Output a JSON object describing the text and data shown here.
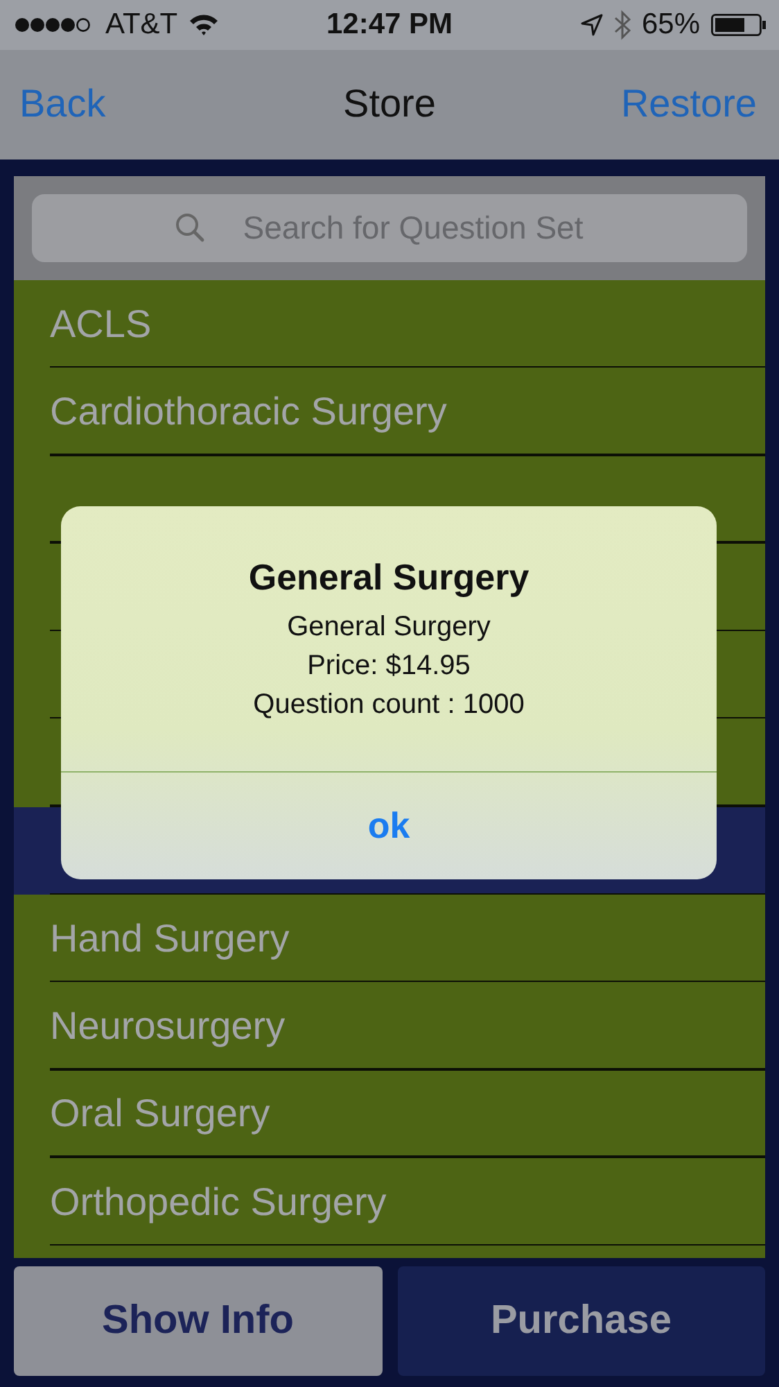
{
  "status_bar": {
    "carrier": "AT&T",
    "time": "12:47 PM",
    "battery": "65%"
  },
  "nav": {
    "back": "Back",
    "title": "Store",
    "restore": "Restore"
  },
  "search": {
    "placeholder": "Search for Question Set"
  },
  "rows": [
    {
      "label": "ACLS",
      "selected": false
    },
    {
      "label": "Cardiothoracic Surgery",
      "selected": false
    },
    {
      "selected": false
    },
    {
      "selected": false
    },
    {
      "selected": false
    },
    {
      "selected": false
    },
    {
      "selected": true
    },
    {
      "label": "Hand Surgery",
      "selected": false
    },
    {
      "label": "Neurosurgery",
      "selected": false
    },
    {
      "label": "Oral Surgery",
      "selected": false
    },
    {
      "label": "Orthopedic Surgery",
      "selected": false
    }
  ],
  "buttons": [
    {
      "label": "Show Info",
      "kind": "light"
    },
    {
      "label": "Purchase",
      "kind": "dark"
    }
  ],
  "alert": {
    "title": "General Surgery",
    "lines": [
      "General Surgery",
      "Price: $14.95",
      "Question count : 1000"
    ],
    "button": "ok"
  }
}
